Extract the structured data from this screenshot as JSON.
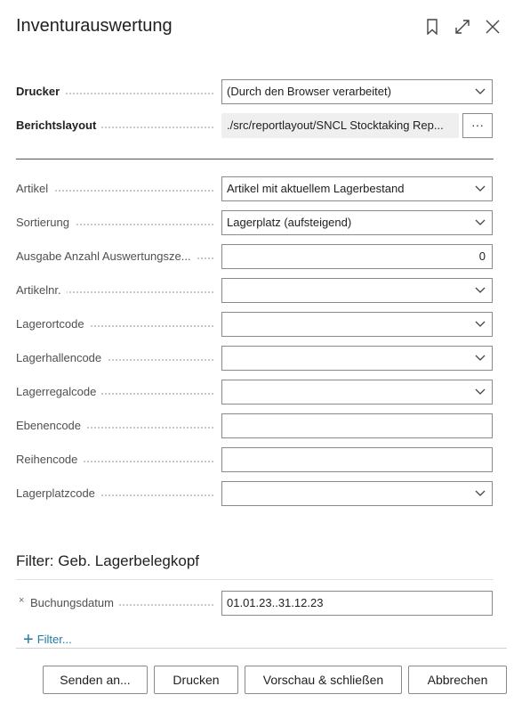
{
  "header": {
    "title": "Inventurauswertung"
  },
  "options": {
    "printer": {
      "label": "Drucker",
      "value": "(Durch den Browser verarbeitet)"
    },
    "layout": {
      "label": "Berichtslayout",
      "value": "./src/reportlayout/SNCL Stocktaking Rep...",
      "button": "···"
    }
  },
  "fields": {
    "artikel": {
      "label": "Artikel",
      "value": "Artikel mit aktuellem Lagerbestand"
    },
    "sortierung": {
      "label": "Sortierung",
      "value": "Lagerplatz (aufsteigend)"
    },
    "ausgabe": {
      "label": "Ausgabe Anzahl Auswertungsze...",
      "value": "0"
    },
    "artikelnr": {
      "label": "Artikelnr.",
      "value": ""
    },
    "lagerortcode": {
      "label": "Lagerortcode",
      "value": ""
    },
    "lagerhallencode": {
      "label": "Lagerhallencode",
      "value": ""
    },
    "lagerregalcode": {
      "label": "Lagerregalcode",
      "value": ""
    },
    "ebenencode": {
      "label": "Ebenencode",
      "value": ""
    },
    "reihencode": {
      "label": "Reihencode",
      "value": ""
    },
    "lagerplatzcode": {
      "label": "Lagerplatzcode",
      "value": ""
    }
  },
  "filter_section": {
    "title": "Filter: Geb. Lagerbelegkopf",
    "remove_symbol": "×",
    "buchungsdatum": {
      "label": "Buchungsdatum",
      "value": "01.01.23..31.12.23"
    },
    "add_filter": "Filter..."
  },
  "footer": {
    "send": "Senden an...",
    "print": "Drucken",
    "preview": "Vorschau & schließen",
    "cancel": "Abbrechen"
  },
  "icons": {
    "bookmark": "bookmark-icon",
    "expand": "expand-icon",
    "close": "close-icon",
    "chevron": "chevron-down-icon",
    "plus": "plus-icon"
  }
}
